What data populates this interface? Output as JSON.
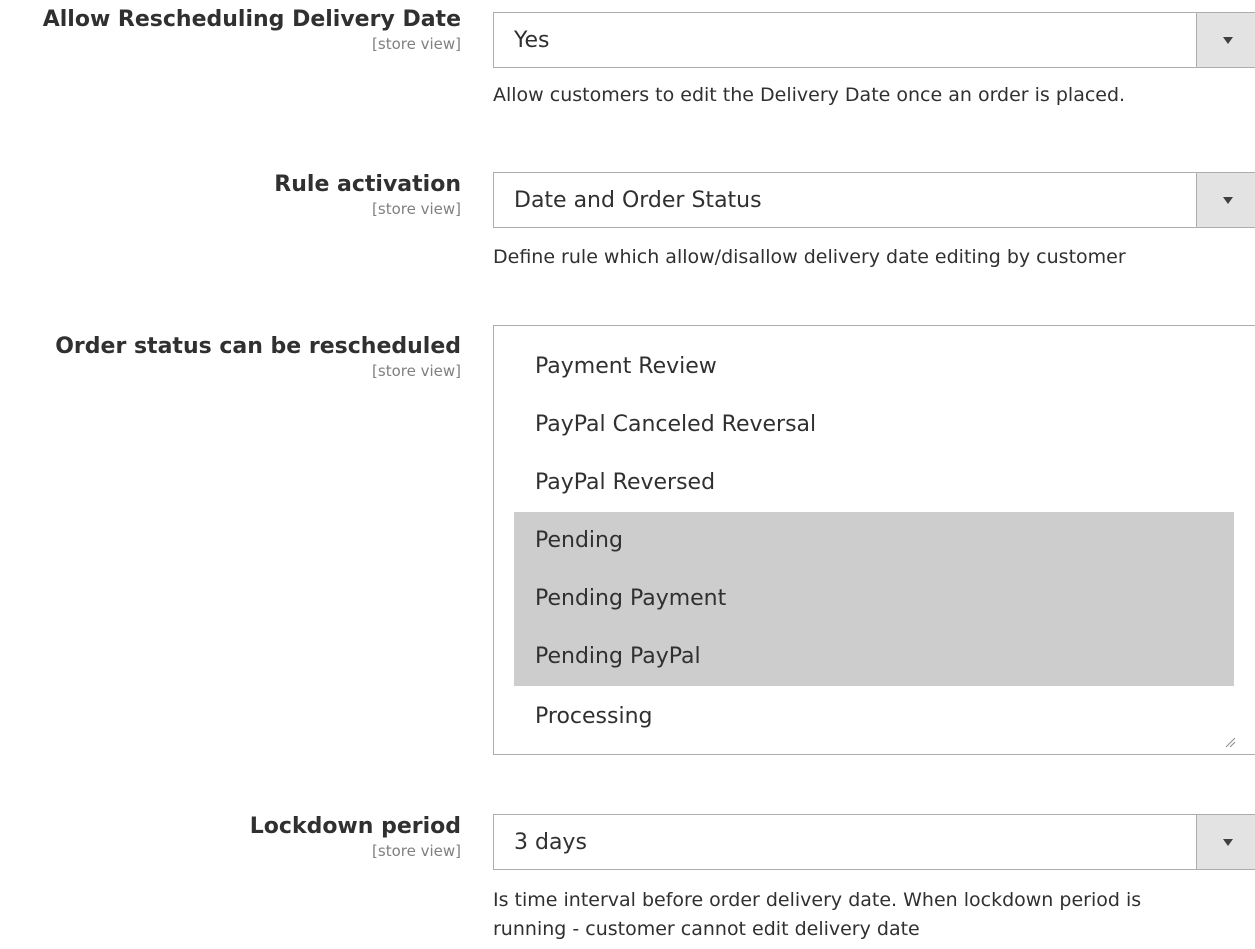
{
  "fields": {
    "allow_rescheduling": {
      "label": "Allow Rescheduling Delivery Date",
      "scope": "[store view]",
      "value": "Yes",
      "note": "Allow customers to edit the Delivery Date once an order is placed."
    },
    "rule_activation": {
      "label": "Rule activation",
      "scope": "[store view]",
      "value": "Date and Order Status",
      "note": "Define rule which allow/disallow delivery date editing by customer"
    },
    "order_status": {
      "label": "Order status can be rescheduled",
      "scope": "[store view]",
      "options": [
        {
          "label": "Payment Review",
          "selected": false
        },
        {
          "label": "PayPal Canceled Reversal",
          "selected": false
        },
        {
          "label": "PayPal Reversed",
          "selected": false
        },
        {
          "label": "Pending",
          "selected": true
        },
        {
          "label": "Pending Payment",
          "selected": true
        },
        {
          "label": "Pending PayPal",
          "selected": true
        },
        {
          "label": "Processing",
          "selected": false
        }
      ]
    },
    "lockdown_period": {
      "label": "Lockdown period",
      "scope": "[store view]",
      "value": "3 days",
      "note_line1": "Is time interval before order delivery date. When lockdown period is",
      "note_line2": "running - customer cannot edit delivery date"
    }
  },
  "icons": {
    "dropdown": "chevron-down-icon",
    "resize": "resize-handle-icon"
  },
  "colors": {
    "border": "#adadad",
    "arrow_bg": "#e3e3e3",
    "selected_bg": "#cdcdcd",
    "text": "#303030",
    "scope_text": "#808080"
  }
}
